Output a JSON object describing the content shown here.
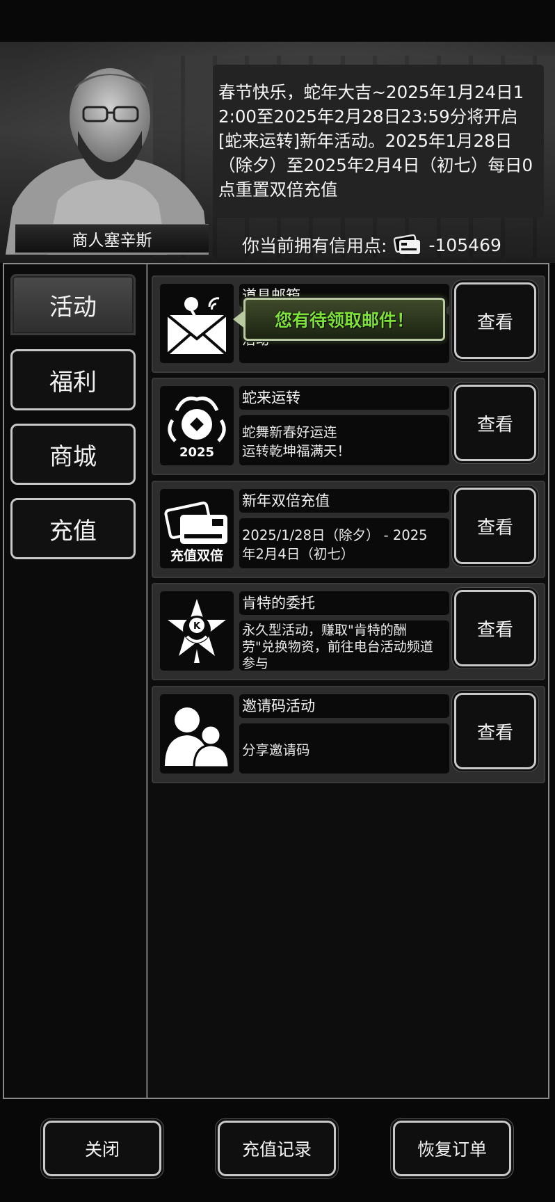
{
  "npc": {
    "name": "商人塞辛斯",
    "message": "春节快乐，蛇年大吉~2025年1月24日12:00至2025年2月28日23:59分将开启[蛇来运转]新年活动。2025年1月28日（除夕）至2025年2月4日（初七）每日0点重置双倍充值"
  },
  "credit": {
    "label": "你当前拥有信用点:",
    "value": "-105469",
    "icon": "credit-card-icon"
  },
  "sidebar": {
    "tabs": [
      {
        "label": "活动",
        "active": true
      },
      {
        "label": "福利",
        "active": false
      },
      {
        "label": "商城",
        "active": false
      },
      {
        "label": "充值",
        "active": false
      }
    ]
  },
  "cards": [
    {
      "title": "道具邮箱",
      "desc_lines": [
        "活动"
      ],
      "icon": "mail-icon",
      "button": "查看",
      "tip": "您有待领取邮件！"
    },
    {
      "title": "蛇来运转",
      "desc_lines": [
        "蛇舞新春好运连",
        "运转乾坤福满天！"
      ],
      "icon": "snake-2025-icon",
      "icon_text": "2025",
      "button": "查看"
    },
    {
      "title": "新年双倍充值",
      "desc_lines": [
        "2025/1/28日（除夕） - 2025",
        "年2月4日（初七）"
      ],
      "icon": "double-recharge-icon",
      "icon_text": "充值双倍",
      "button": "查看"
    },
    {
      "title": "肯特的委托",
      "desc_lines": [
        "永久型活动，赚取\"肯特的酬",
        "劳\"兑换物资，前往电台活动频道",
        "参与"
      ],
      "icon": "kent-emblem-icon",
      "icon_text": "K",
      "button": "查看"
    },
    {
      "title": "邀请码活动",
      "desc_lines": [
        "分享邀请码"
      ],
      "icon": "invite-users-icon",
      "button": "查看"
    }
  ],
  "footer": {
    "close": "关闭",
    "history": "充值记录",
    "restore": "恢复订单"
  }
}
